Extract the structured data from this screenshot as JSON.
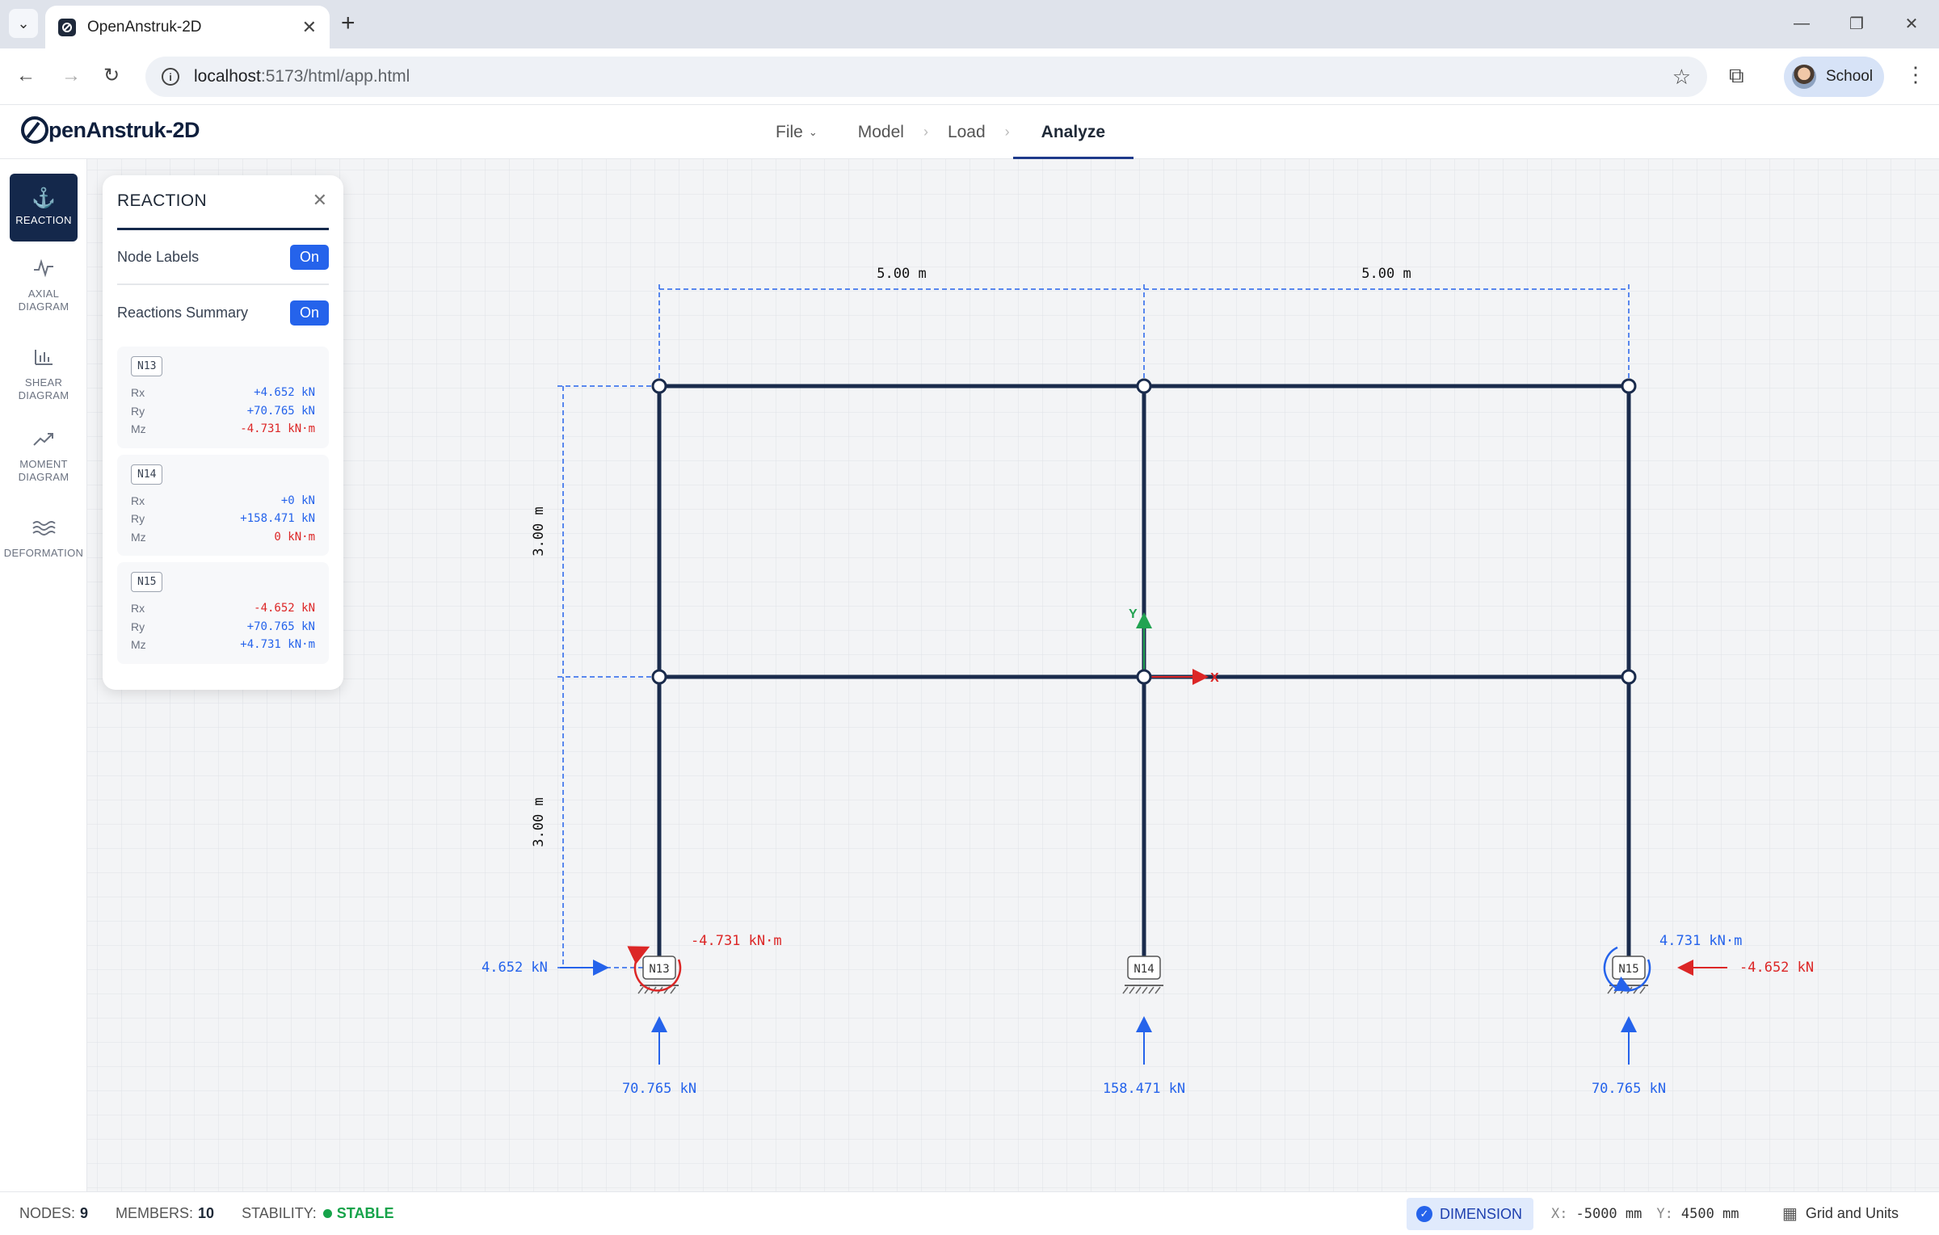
{
  "browser": {
    "tab_title": "OpenAnstruk-2D",
    "url_host": "localhost",
    "url_rest": ":5173/html/app.html",
    "profile_name": "School"
  },
  "app": {
    "logo_text": "penAnstruk-2D",
    "nav": [
      "File",
      "Model",
      "Load",
      "Analyze"
    ],
    "active_nav": "Analyze"
  },
  "rail": [
    {
      "label": "REACTION",
      "icon": "anchor-icon",
      "active": true
    },
    {
      "label": "AXIAL DIAGRAM",
      "icon": "pulse-icon",
      "active": false
    },
    {
      "label": "SHEAR DIAGRAM",
      "icon": "bar-chart-icon",
      "active": false
    },
    {
      "label": "MOMENT DIAGRAM",
      "icon": "trend-icon",
      "active": false
    },
    {
      "label": "DEFORMATION",
      "icon": "waves-icon",
      "active": false
    }
  ],
  "panel": {
    "title": "REACTION",
    "node_labels": {
      "label": "Node Labels",
      "state": "On"
    },
    "reactions_summary": {
      "label": "Reactions Summary",
      "state": "On"
    },
    "nodes": [
      {
        "id": "N13",
        "rx": "+4.652 kN",
        "ry": "+70.765 kN",
        "mz": "-4.731 kN·m"
      },
      {
        "id": "N14",
        "rx": "+0 kN",
        "ry": "+158.471 kN",
        "mz": "0 kN·m"
      },
      {
        "id": "N15",
        "rx": "-4.652 kN",
        "ry": "+70.765 kN",
        "mz": "+4.731 kN·m"
      }
    ],
    "row_keys": {
      "rx": "Rx",
      "ry": "Ry",
      "mz": "Mz"
    }
  },
  "model": {
    "dim_h1": "5.00 m",
    "dim_h2": "5.00 m",
    "dim_v1": "3.00 m",
    "dim_v2": "3.00 m",
    "support_labels": [
      "N13",
      "N14",
      "N15"
    ],
    "reactions": {
      "n13_h": "4.652 kN",
      "n13_m": "-4.731 kN·m",
      "n13_v": "70.765 kN",
      "n14_v": "158.471 kN",
      "n15_h": "-4.652 kN",
      "n15_m": "4.731 kN·m",
      "n15_v": "70.765 kN"
    },
    "axis_x": "X",
    "axis_y": "Y",
    "colors": {
      "member": "#1a2b4c",
      "positive": "#2563eb",
      "negative": "#dc2626",
      "axis_y": "#22a352"
    }
  },
  "status": {
    "nodes_label": "NODES:",
    "nodes_value": "9",
    "members_label": "MEMBERS:",
    "members_value": "10",
    "stability_label": "STABILITY:",
    "stability_value": "STABLE",
    "dimension_btn": "DIMENSION",
    "x_label": "X:",
    "x_value": "-5000 mm",
    "y_label": "Y:",
    "y_value": "4500 mm",
    "grid_units": "Grid and Units"
  }
}
